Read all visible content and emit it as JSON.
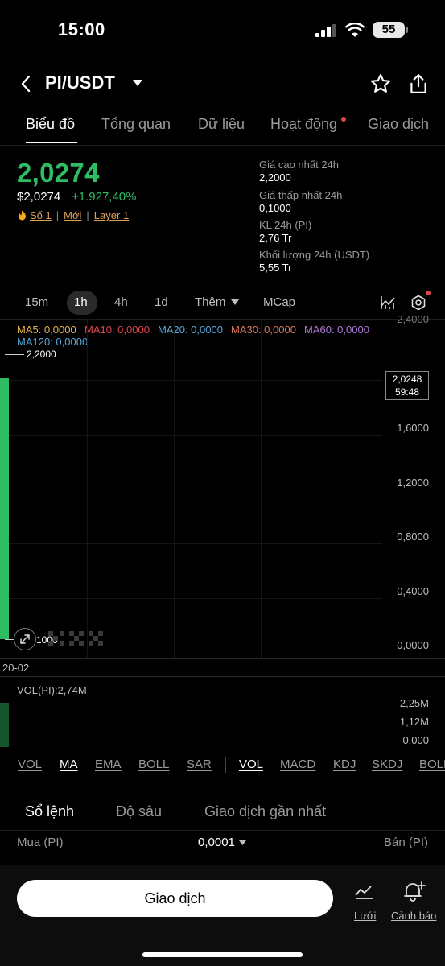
{
  "status_bar": {
    "time": "15:00",
    "battery": "55"
  },
  "header": {
    "pair": "PI/USDT"
  },
  "tabs": [
    {
      "label": "Biểu đồ",
      "active": true
    },
    {
      "label": "Tổng quan"
    },
    {
      "label": "Dữ liệu"
    },
    {
      "label": "Hoạt động",
      "has_dot": true
    },
    {
      "label": "Giao dịch"
    }
  ],
  "price": {
    "last": "2,0274",
    "usd": "$2,0274",
    "change_pct": "+1.927,40%",
    "tags": [
      "Số 1",
      "Mới",
      "Layer 1"
    ],
    "tag_icon": "fire-icon"
  },
  "stats": [
    {
      "label": "Giá cao nhất 24h",
      "value": "2,2000"
    },
    {
      "label": "Giá thấp nhất 24h",
      "value": "0,1000"
    },
    {
      "label": "KL 24h (PI)",
      "value": "2,76 Tr"
    },
    {
      "label": "Khối lượng 24h (USDT)",
      "value": "5,55 Tr"
    }
  ],
  "timeframes": [
    "15m",
    "1h",
    "4h",
    "1d",
    "Thêm",
    "MCap"
  ],
  "timeframe_selected": "1h",
  "ma_legend": {
    "ma5": "MA5: 0,0000",
    "ma10": "MA10: 0,0000",
    "ma20": "MA20: 0,0000",
    "ma30": "MA30: 0,0000",
    "ma60": "MA60: 0,0000",
    "ma120": "MA120: 0,0000"
  },
  "colors": {
    "up": "#2ebd63",
    "ma5": "#e8b44c",
    "ma10": "#e0464e",
    "ma20": "#5aa6d8",
    "ma30": "#e0775c",
    "ma60": "#b07ad8",
    "ma120": "#5aa6d8",
    "tag": "#d9a05a"
  },
  "chart": {
    "y_axis": [
      "2,4000",
      "1,6000",
      "1,2000",
      "0,8000",
      "0,4000",
      "0,0000"
    ],
    "high_label": "2,2000",
    "low_label": "1000",
    "current_price": "2,0248",
    "countdown": "59:48",
    "date_label": "20-02"
  },
  "chart_data": {
    "type": "candlestick",
    "candles": [
      {
        "open": 0.1,
        "high": 2.2,
        "low": 0.1,
        "close": 2.0248
      }
    ],
    "ylim": [
      0,
      2.4
    ],
    "volume": {
      "title": "VOL(PI):2,74M",
      "axis": [
        "2,25M",
        "1,12M",
        "0,000"
      ],
      "values": [
        2.74
      ]
    }
  },
  "indicators_main": [
    "VOL",
    "MA",
    "EMA",
    "BOLL",
    "SAR"
  ],
  "indicators_sub": [
    "VOL",
    "MACD",
    "KDJ",
    "SKDJ",
    "BOLL"
  ],
  "order_book": {
    "tabs": [
      "Sổ lệnh",
      "Độ sâu",
      "Giao dịch gần nhất"
    ],
    "buy_label": "Mua (PI)",
    "precision": "0,0001",
    "sell_label": "Bán (PI)"
  },
  "bottom": {
    "trade_button": "Giao dịch",
    "grid_label": "Lưới",
    "alert_label": "Cảnh báo"
  }
}
